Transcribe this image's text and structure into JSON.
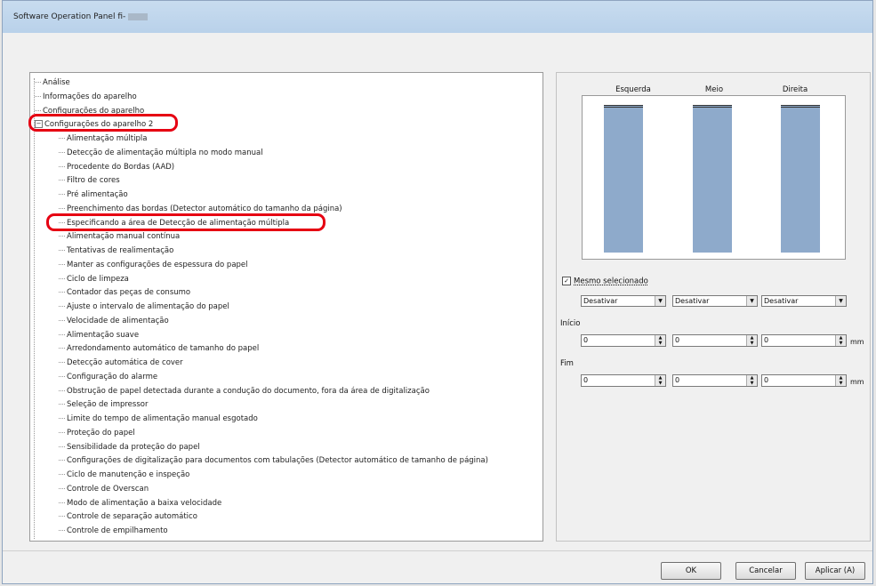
{
  "window": {
    "title": "Software Operation Panel fi-"
  },
  "tree": {
    "items": [
      "Análise",
      "Informações do aparelho",
      "Configurações do aparelho",
      "Configurações do aparelho 2",
      "Alimentação múltipla",
      "Detecção de alimentação múltipla no modo manual",
      "Procedente do Bordas (AAD)",
      "Filtro de cores",
      "Pré alimentação",
      "Preenchimento das bordas (Detector automático do tamanho da página)",
      "Especificando a área de Detecção de alimentação múltipla",
      "Alimentação manual contínua",
      "Tentativas de realimentação",
      "Manter as configurações de espessura do papel",
      "Ciclo de limpeza",
      "Contador das peças de consumo",
      "Ajuste o intervalo de alimentação do papel",
      "Velocidade de alimentação",
      "Alimentação suave",
      "Arredondamento automático de tamanho do papel",
      "Detecção automática de cover",
      "Configuração do alarme",
      "Obstrução de papel detectada durante a condução do documento, fora da área de digitalização",
      "Seleção de impressor",
      "Limite do tempo de alimentação manual esgotado",
      "Proteção do papel",
      "Sensibilidade da proteção do papel",
      "Configurações de digitalização para documentos com tabulações (Detector automático de tamanho de página)",
      "Ciclo de manutenção e inspeção",
      "Controle de Overscan",
      "Modo de alimentação a baixa velocidade",
      "Controle de separação automático",
      "Controle de empilhamento"
    ]
  },
  "area": {
    "columns": [
      "Esquerda",
      "Meio",
      "Direita"
    ],
    "same_setting_label": "Mesmo selecionado",
    "same_setting_checked": true,
    "selects": [
      "Desativar",
      "Desativar",
      "Desativar"
    ],
    "start_label": "Início",
    "start_values": [
      "0",
      "0",
      "0"
    ],
    "end_label": "Fim",
    "end_values": [
      "0",
      "0",
      "0"
    ],
    "unit": "mm"
  },
  "buttons": {
    "ok": "OK",
    "cancel": "Cancelar",
    "apply": "Aplicar (A)"
  },
  "colors": {
    "highlight": "#e60012",
    "bar": "#8eaacb"
  }
}
